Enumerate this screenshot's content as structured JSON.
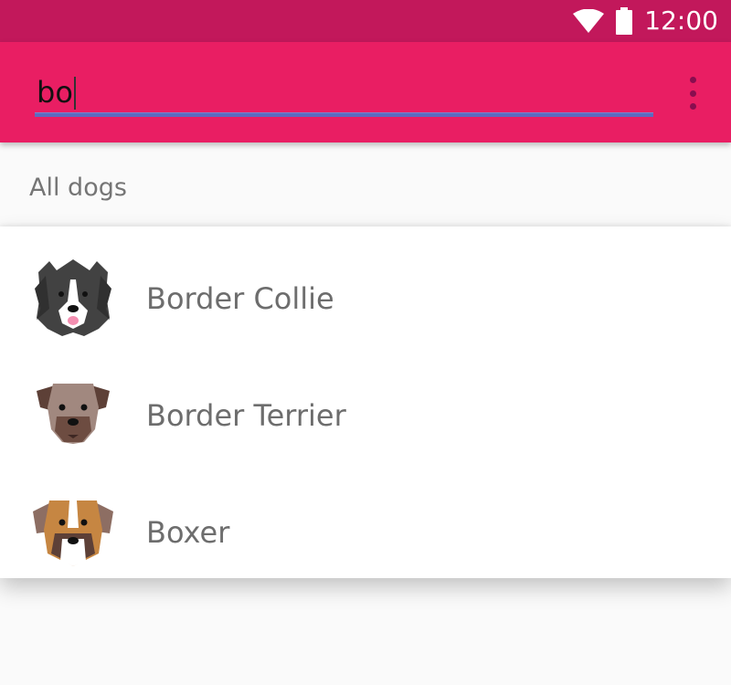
{
  "status_bar": {
    "time": "12:00",
    "icons": [
      "wifi-icon",
      "battery-icon"
    ]
  },
  "search": {
    "query": "bo"
  },
  "menu": {
    "icon": "more-vert-icon"
  },
  "section": {
    "header": "All dogs"
  },
  "results": [
    {
      "name": "Border Collie",
      "icon": "border-collie-avatar"
    },
    {
      "name": "Border Terrier",
      "icon": "border-terrier-avatar"
    },
    {
      "name": "Boxer",
      "icon": "boxer-avatar"
    }
  ],
  "colors": {
    "status_bar": "#c2185b",
    "app_bar": "#e91e63",
    "underline": "#5c6bc0",
    "label_text": "#6d6d6d"
  }
}
